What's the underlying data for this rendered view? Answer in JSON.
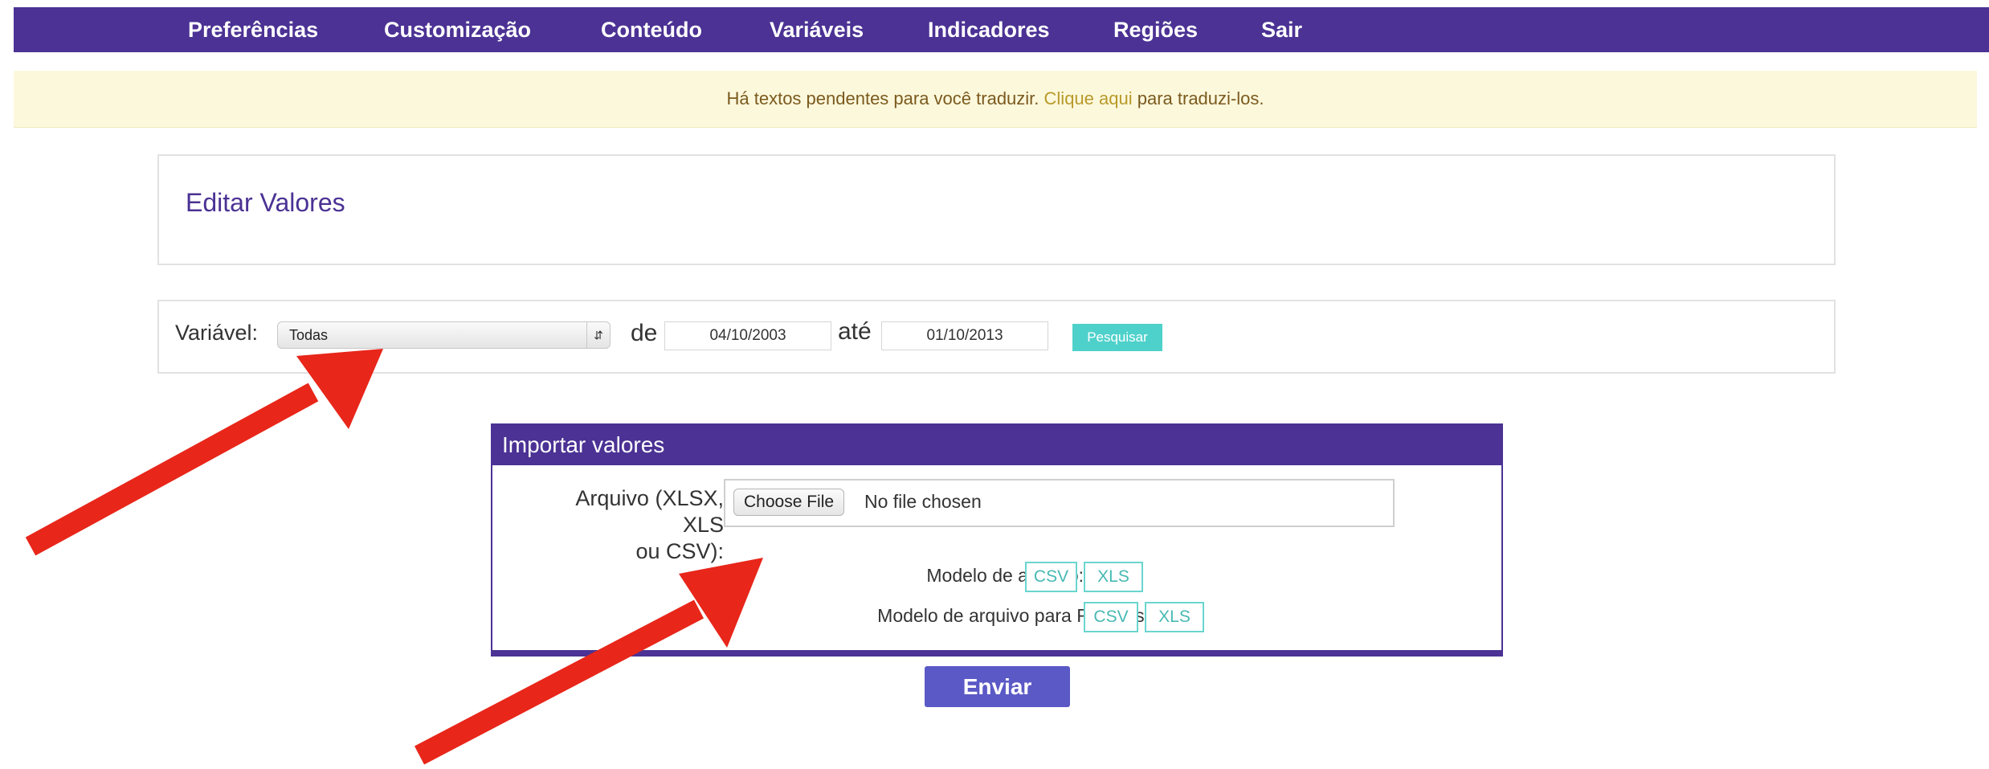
{
  "nav": {
    "items": [
      "Preferências",
      "Customização",
      "Conteúdo",
      "Variáveis",
      "Indicadores",
      "Regiões",
      "Sair"
    ]
  },
  "alert": {
    "text_before": "Há textos pendentes para você traduzir.",
    "link": "Clique aqui",
    "text_after": "para traduzi-los."
  },
  "edit_panel": {
    "title": "Editar Valores"
  },
  "filter": {
    "variable_label": "Variável:",
    "variable_selected": "Todas",
    "from_label": "de",
    "from_value": "04/10/2003",
    "to_label": "até",
    "to_value": "01/10/2013",
    "search_button": "Pesquisar"
  },
  "import": {
    "title": "Importar valores",
    "file_label_line1": "Arquivo (XLSX, XLS",
    "file_label_line2": "ou CSV):",
    "choose_button": "Choose File",
    "no_file": "No file chosen",
    "template_label": "Modelo de arquivo:",
    "template_regions_label": "Modelo de arquivo para Regiões:",
    "csv": "CSV",
    "xls": "XLS"
  },
  "submit_button": "Enviar",
  "colors": {
    "brand": "#4b3294",
    "accent": "#4fd1cb",
    "annotation_arrow": "#e8261a"
  }
}
